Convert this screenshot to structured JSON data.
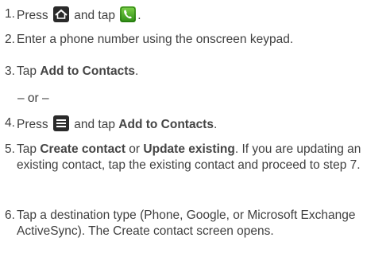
{
  "steps": [
    {
      "number": "1.",
      "parts": [
        "Press",
        "and tap",
        "."
      ],
      "icons": [
        "home-key-icon",
        "phone-app-icon"
      ]
    },
    {
      "number": "2.",
      "text": "Enter a phone number using the onscreen keypad."
    },
    {
      "number": "3.",
      "prefix": "Tap ",
      "bold": "Add to Contacts",
      "suffix": "."
    },
    {
      "or": "– or –"
    },
    {
      "number": "4.",
      "prefix": "Press",
      "middle": "and tap ",
      "bold": "Add to Contacts",
      "suffix": ".",
      "icons": [
        "menu-key-icon"
      ]
    },
    {
      "number": "5.",
      "prefix": "Tap ",
      "bold1": "Create contact",
      "mid": " or ",
      "bold2": "Update existing",
      "suffix": ". If you are updating an existing contact, tap the existing contact and proceed to step 7."
    },
    {
      "number": "6.",
      "text": "Tap a destination type (Phone, Google, or Microsoft Exchange ActiveSync). The Create contact screen opens."
    }
  ]
}
